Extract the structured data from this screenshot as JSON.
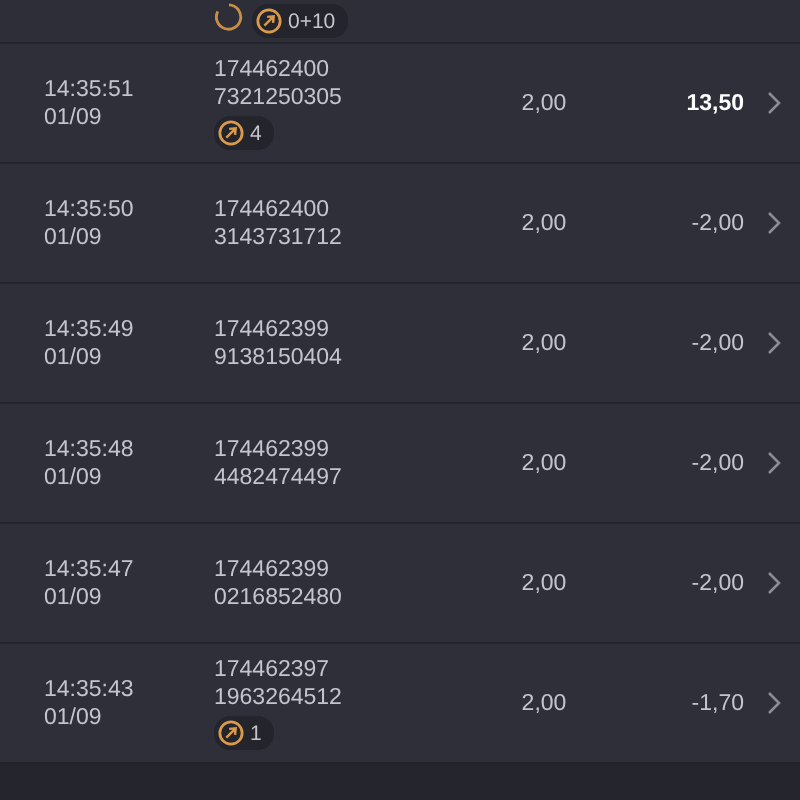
{
  "top_row": {
    "badges": [
      {
        "kind": "spinner"
      },
      {
        "kind": "coin",
        "label": "0+10"
      }
    ]
  },
  "rows": [
    {
      "time": "14:35:51",
      "date": "01/09",
      "id_1": "174462400",
      "id_2": "7321250305",
      "badges": [
        {
          "kind": "coin",
          "label": "4"
        }
      ],
      "stake": "2,00",
      "result": "13,50",
      "win": true
    },
    {
      "time": "14:35:50",
      "date": "01/09",
      "id_1": "174462400",
      "id_2": "3143731712",
      "badges": [],
      "stake": "2,00",
      "result": "-2,00",
      "win": false
    },
    {
      "time": "14:35:49",
      "date": "01/09",
      "id_1": "174462399",
      "id_2": "9138150404",
      "badges": [],
      "stake": "2,00",
      "result": "-2,00",
      "win": false
    },
    {
      "time": "14:35:48",
      "date": "01/09",
      "id_1": "174462399",
      "id_2": "4482474497",
      "badges": [],
      "stake": "2,00",
      "result": "-2,00",
      "win": false
    },
    {
      "time": "14:35:47",
      "date": "01/09",
      "id_1": "174462399",
      "id_2": "0216852480",
      "badges": [],
      "stake": "2,00",
      "result": "-2,00",
      "win": false
    },
    {
      "time": "14:35:43",
      "date": "01/09",
      "id_1": "174462397",
      "id_2": "1963264512",
      "badges": [
        {
          "kind": "coin",
          "label": "1"
        }
      ],
      "stake": "2,00",
      "result": "-1,70",
      "win": false
    }
  ]
}
